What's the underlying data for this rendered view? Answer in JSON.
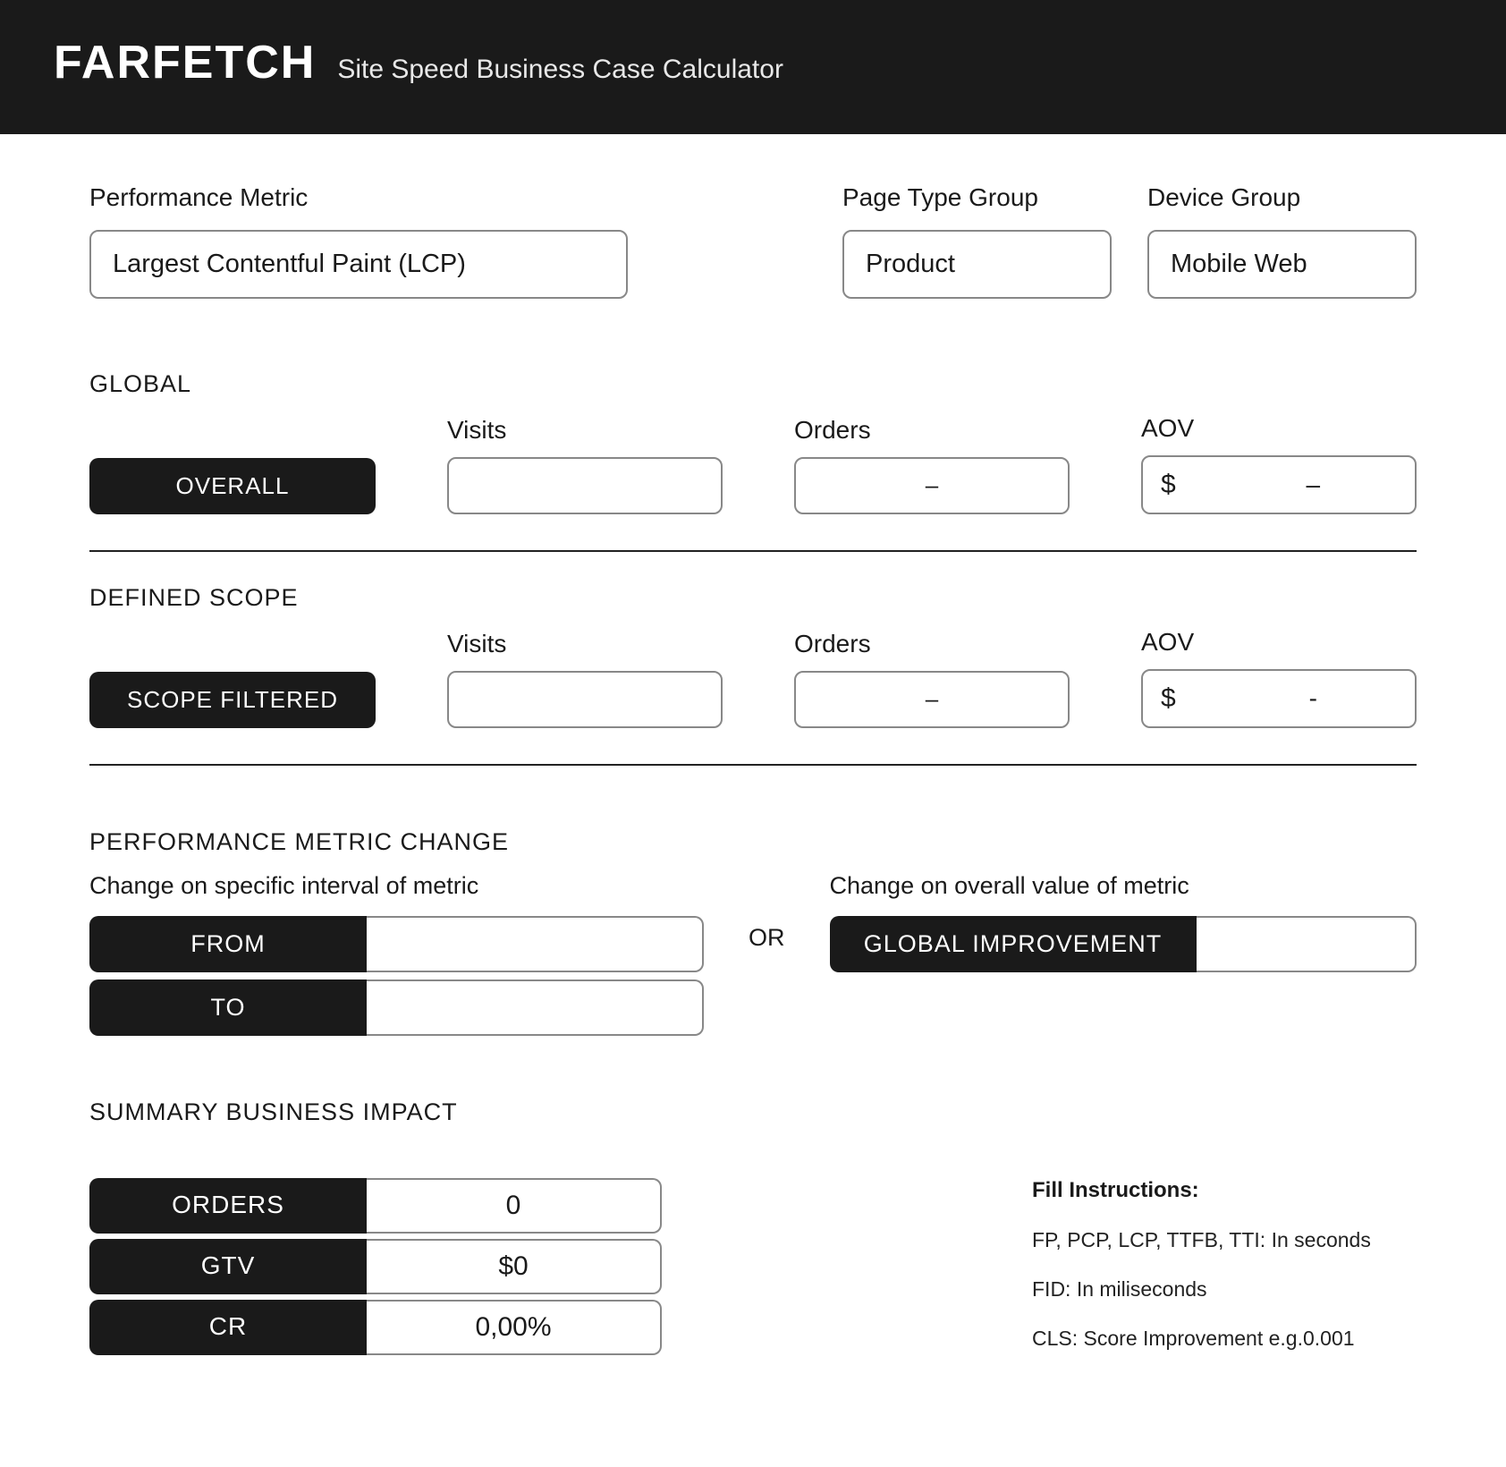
{
  "header": {
    "logo": "FARFETCH",
    "subtitle": "Site Speed Business Case Calculator"
  },
  "filters": {
    "metric_label": "Performance Metric",
    "metric_value": "Largest Contentful Paint (LCP)",
    "pagetype_label": "Page Type Group",
    "pagetype_value": "Product",
    "device_label": "Device Group",
    "device_value": "Mobile Web"
  },
  "global": {
    "section_label": "GLOBAL",
    "tag": "OVERALL",
    "visits_label": "Visits",
    "visits_value": "",
    "orders_label": "Orders",
    "orders_value": "–",
    "aov_label": "AOV",
    "aov_prefix": "$",
    "aov_value": "–"
  },
  "scope": {
    "section_label": "DEFINED SCOPE",
    "tag": "SCOPE FILTERED",
    "visits_label": "Visits",
    "visits_value": "",
    "orders_label": "Orders",
    "orders_value": "–",
    "aov_label": "AOV",
    "aov_prefix": "$",
    "aov_value": "-"
  },
  "change": {
    "section_label": "PERFORMANCE METRIC CHANGE",
    "interval_label": "Change on specific interval of metric",
    "from_tag": "FROM",
    "from_value": "",
    "to_tag": "TO",
    "to_value": "",
    "or_label": "OR",
    "overall_label": "Change on overall value of metric",
    "global_tag": "GLOBAL IMPROVEMENT",
    "global_value": ""
  },
  "summary": {
    "section_label": "SUMMARY BUSINESS IMPACT",
    "rows": [
      {
        "label": "ORDERS",
        "value": "0"
      },
      {
        "label": "GTV",
        "value": "$0"
      },
      {
        "label": "CR",
        "value": "0,00%"
      }
    ]
  },
  "instructions": {
    "title": "Fill Instructions:",
    "lines": [
      "FP, PCP, LCP, TTFB, TTI: In seconds",
      "FID: In miliseconds",
      "CLS: Score Improvement e.g.0.001"
    ]
  }
}
